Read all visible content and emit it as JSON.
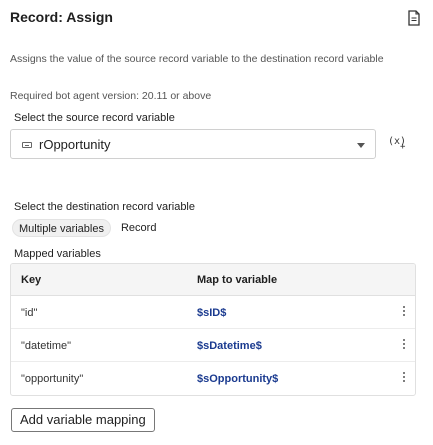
{
  "panel": {
    "title": "Record: Assign",
    "description": "Assigns the value of the source record variable to the destination record variable",
    "required_version": "Required bot agent version: 20.11 or above"
  },
  "source": {
    "label": "Select the source record variable",
    "value": "rOpportunity",
    "insert_variable_icon": "(x)+"
  },
  "destination": {
    "label": "Select the destination record variable",
    "tabs": [
      {
        "label": "Multiple variables",
        "active": true
      },
      {
        "label": "Record",
        "active": false
      }
    ]
  },
  "mapping": {
    "label": "Mapped variables",
    "columns": {
      "key": "Key",
      "map": "Map to variable"
    },
    "rows": [
      {
        "key": "\"id\"",
        "map": "$sID$"
      },
      {
        "key": "\"datetime\"",
        "map": "$sDatetime$"
      },
      {
        "key": "\"opportunity\"",
        "map": "$sOpportunity$"
      }
    ],
    "add_button": "Add variable mapping"
  }
}
